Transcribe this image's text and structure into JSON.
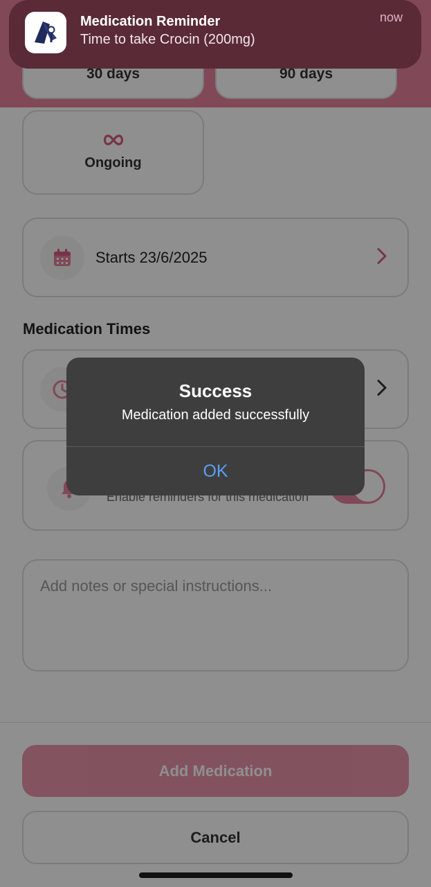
{
  "notification": {
    "title": "Medication Reminder",
    "body": "Time to take Crocin (200mg)",
    "time": "now",
    "icon": "app-logo-icon"
  },
  "duration": {
    "options": [
      {
        "label": "30 days"
      },
      {
        "label": "90 days"
      },
      {
        "label": "Ongoing",
        "icon": "infinity-icon"
      }
    ]
  },
  "start_date": {
    "label": "Starts 23/6/2025",
    "icon": "calendar-icon"
  },
  "times_section": {
    "title": "Medication Times",
    "icon": "clock-icon"
  },
  "reminders": {
    "subtitle": "Enable reminders for this medication",
    "enabled": true,
    "icon": "bell-icon"
  },
  "notes": {
    "placeholder": "Add notes or special instructions..."
  },
  "buttons": {
    "add": "Add Medication",
    "cancel": "Cancel"
  },
  "alert": {
    "title": "Success",
    "message": "Medication added successfully",
    "ok": "OK"
  },
  "colors": {
    "accent": "#e6819b",
    "accent_dark": "#d85b7d",
    "alert_button": "#5aa0f2"
  }
}
